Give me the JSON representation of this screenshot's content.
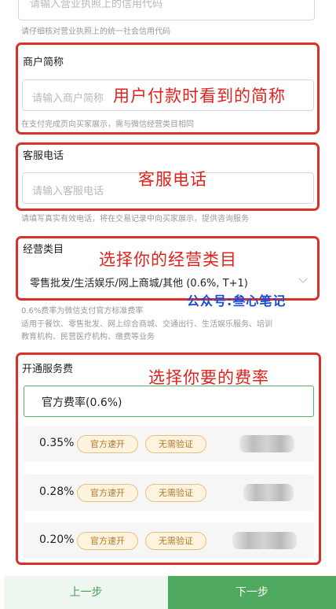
{
  "license": {
    "placeholder": "请输入营业执照上的信用代码",
    "hint": "请仔细核对营业执照上的统一社会信用代码"
  },
  "merchant_short_name": {
    "label": "商户简称",
    "placeholder": "请输入商户简称",
    "hint": "在支付完成页向买家展示，需与微信经营类目相同",
    "annotation": "用户付款时看到的简称"
  },
  "service_phone": {
    "label": "客服电话",
    "placeholder": "请输入客服电话",
    "hint": "请填写真实有效电话，将在交易记录中向买家展示，提供咨询服务",
    "annotation": "客服电话"
  },
  "business_category": {
    "label": "经营类目",
    "value": "零售批发/生活娱乐/网上商城/其他 (0.6%, T+1)",
    "annotation": "选择你的经营类目",
    "hint_1": "0.6%费率为微信支付官方标准费率",
    "hint_2": "适用于餐饮、零售批发、网上综合商城、交通出行、生活娱乐服务、培训",
    "hint_3": "教育机构、民营医疗机构、缴费等业务"
  },
  "watermark": "公众号:叁心笔记",
  "service_fee": {
    "label": "开通服务费",
    "annotation": "选择你要的费率",
    "official_option": "官方费率(0.6%)",
    "rates": [
      {
        "value": "0.35%",
        "tag_fast": "官方速开",
        "tag_noverify": "无需验证"
      },
      {
        "value": "0.28%",
        "tag_fast": "官方速开",
        "tag_noverify": "无需验证"
      },
      {
        "value": "0.20%",
        "tag_fast": "官方速开",
        "tag_noverify": "无需验证"
      }
    ]
  },
  "footer": {
    "prev": "上一步",
    "next": "下一步"
  },
  "colors": {
    "accent_green": "#4faa5f",
    "annotation_red": "#e0221c",
    "watermark_blue": "#1b4bd6"
  }
}
